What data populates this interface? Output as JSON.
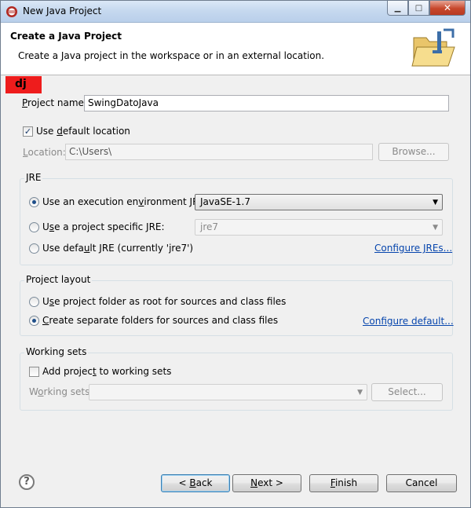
{
  "window": {
    "title": "New Java Project",
    "min_symbol": "▁",
    "max_symbol": "□",
    "close_symbol": "✕"
  },
  "banner": {
    "title": "Create a Java Project",
    "description": "Create a Java project in the workspace or in an external location."
  },
  "error_tag": {
    "text": "dj",
    "color": "#ee1c1c"
  },
  "project": {
    "name_label_u": "P",
    "name_label_rest": "roject name:",
    "name_value": "SwingDatoJava",
    "use_default_pre": "Use ",
    "use_default_u": "d",
    "use_default_post": "efault location",
    "use_default_checked": "✓",
    "location_label_u": "L",
    "location_label_rest": "ocation:",
    "location_value": "C:\\Users\\",
    "browse_label": "Browse..."
  },
  "jre": {
    "group_title": "JRE",
    "opt1_pre": "Use an execution en",
    "opt1_u": "v",
    "opt1_post": "ironment JRE:",
    "opt1_value": "JavaSE-1.7",
    "opt2_pre": "U",
    "opt2_u": "s",
    "opt2_post": "e a project specific JRE:",
    "opt2_value": "jre7",
    "opt3_pre": "Use defa",
    "opt3_u": "u",
    "opt3_post": "lt JRE (currently 'jre7')",
    "configure_link": "Configure JREs...",
    "dropdown_arrow": "▼"
  },
  "layout": {
    "group_title": "Project layout",
    "opt1_pre": "U",
    "opt1_u": "s",
    "opt1_post": "e project folder as root for sources and class files",
    "opt2_pre": "",
    "opt2_u": "C",
    "opt2_post": "reate separate folders for sources and class files",
    "configure_link": "Configure default..."
  },
  "working_sets": {
    "group_title": "Working sets",
    "add_pre": "Add projec",
    "add_u": "t",
    "add_post": " to working sets",
    "sets_label_pre": "W",
    "sets_label_u": "o",
    "sets_label_post": "rking sets:",
    "select_label": "Select...",
    "dropdown_arrow": "▼"
  },
  "footer": {
    "help_symbol": "?",
    "back_label_pre": "< ",
    "back_label_u": "B",
    "back_label_post": "ack",
    "next_label_u": "N",
    "next_label_post": "ext >",
    "finish_label_u": "F",
    "finish_label_post": "inish",
    "cancel_label": "Cancel"
  }
}
